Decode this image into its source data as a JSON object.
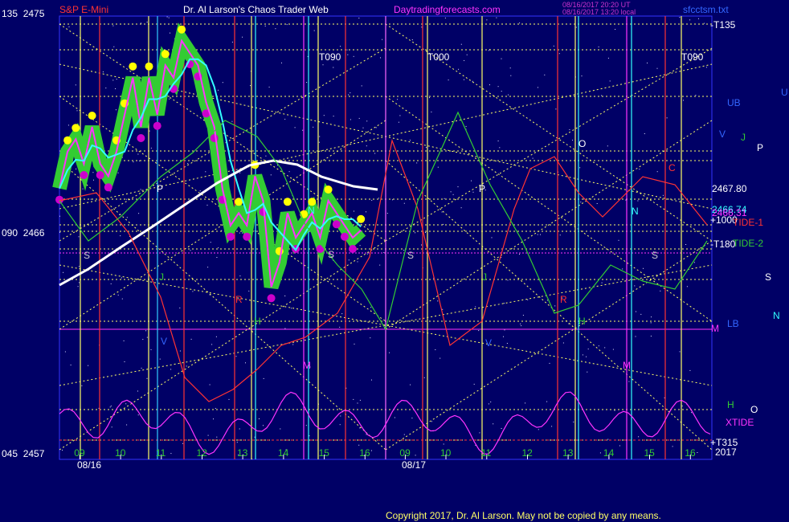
{
  "header": {
    "symbol": "S&P E-Mini",
    "title": "Dr. Al Larson's Chaos Trader Web",
    "site": "Daytradingforecasts.com",
    "stamp1": "08/16/2017 20:20 UT",
    "stamp2": "08/16/2017 13:20 local",
    "file": "sfcctsm.txt",
    "colors": {
      "symbol": "#ff3333",
      "title": "#ffffff",
      "site": "#ff33ff",
      "stamp": "#cc33cc",
      "file": "#3366ff"
    }
  },
  "footer": {
    "copyright": "Copyright 2017, Dr. Al Larson. May not be copied by any means."
  },
  "left_axis": {
    "top": "135  2475",
    "mid": "090  2466",
    "bottom": "045  2457"
  },
  "right_labels": {
    "t135": "-T135",
    "ub": "UB",
    "v": "V",
    "j": "J",
    "o": "O",
    "p": "P",
    "u": "U",
    "price_a": "2467.80",
    "price_b": "2466.74",
    "price_c": "2466.31",
    "plus1000": "+1000",
    "tide1": "TIDE-1",
    "t180": "-T180",
    "tide2": "TIDE-2",
    "s": "S",
    "n": "N",
    "lb": "LB",
    "m": "M",
    "h": "H",
    "o2": "O",
    "xtide": "XTIDE",
    "plus315": "+T315",
    "year": "2017"
  },
  "markers": {
    "t090a": "T090",
    "t000": "T000",
    "t090b": "T090",
    "s1": "S",
    "p1": "P",
    "j1": "J",
    "v1": "V",
    "r1": "R",
    "h1": "H",
    "m1": "M",
    "n1": "N",
    "s2": "S",
    "s3": "S",
    "p2": "P",
    "j2": "J",
    "v2": "V",
    "r2": "R",
    "h2": "H",
    "m2": "M",
    "o1": "O",
    "c1": "C",
    "n2": "N",
    "s4": "S"
  },
  "chart_data": {
    "type": "line",
    "title": "S&P E-Mini",
    "x_tick_labels": [
      "09",
      "10",
      "11",
      "12",
      "13",
      "14",
      "15",
      "16",
      "09",
      "10",
      "11",
      "12",
      "13",
      "14",
      "15",
      "16"
    ],
    "date_labels": [
      "08/16",
      "08/17"
    ],
    "y_axis_labels": [
      "2475",
      "2466",
      "2457"
    ],
    "ylim": [
      2457,
      2475
    ],
    "price_series": {
      "name": "S&P E-Mini",
      "x_hours": [
        8.5,
        8.7,
        8.9,
        9.1,
        9.3,
        9.5,
        9.7,
        9.9,
        10.1,
        10.3,
        10.5,
        10.7,
        10.9,
        11.1,
        11.3,
        11.5,
        11.7,
        11.9,
        12.1,
        12.3,
        12.5,
        12.7,
        12.9,
        13.1,
        13.3,
        13.5,
        13.7,
        13.9,
        14.1,
        14.3,
        14.5,
        14.7,
        14.9,
        15.1,
        15.3,
        15.5,
        15.7,
        15.9
      ],
      "values": [
        2468.0,
        2469.5,
        2470.0,
        2469.0,
        2470.5,
        2469.0,
        2468.5,
        2469.5,
        2471.0,
        2472.5,
        2470.5,
        2472.5,
        2471.0,
        2473.0,
        2472.5,
        2474.0,
        2473.5,
        2473.0,
        2471.5,
        2470.5,
        2468.0,
        2466.5,
        2467.0,
        2466.5,
        2468.5,
        2467.5,
        2464.0,
        2465.0,
        2467.0,
        2466.0,
        2466.5,
        2467.0,
        2466.0,
        2467.5,
        2467.0,
        2466.5,
        2466.0,
        2466.3
      ]
    },
    "annotations": [
      "T090",
      "T000",
      "T090",
      "TIDE-1",
      "TIDE-2",
      "XTIDE",
      "UB",
      "LB",
      "2467.80",
      "2466.74",
      "2466.31"
    ],
    "colors": {
      "price": "#ff33ff",
      "price_glow": "#33cc33",
      "highs": "#ffff00",
      "lows": "#cc00cc",
      "cyan_avg": "#33ffff",
      "white_avg": "#ffffff",
      "tide1": "#ff3333",
      "tide2": "#33cc33",
      "xtide": "#ff33ff",
      "grid": "#ffff66",
      "band": "#ff33ff"
    }
  }
}
